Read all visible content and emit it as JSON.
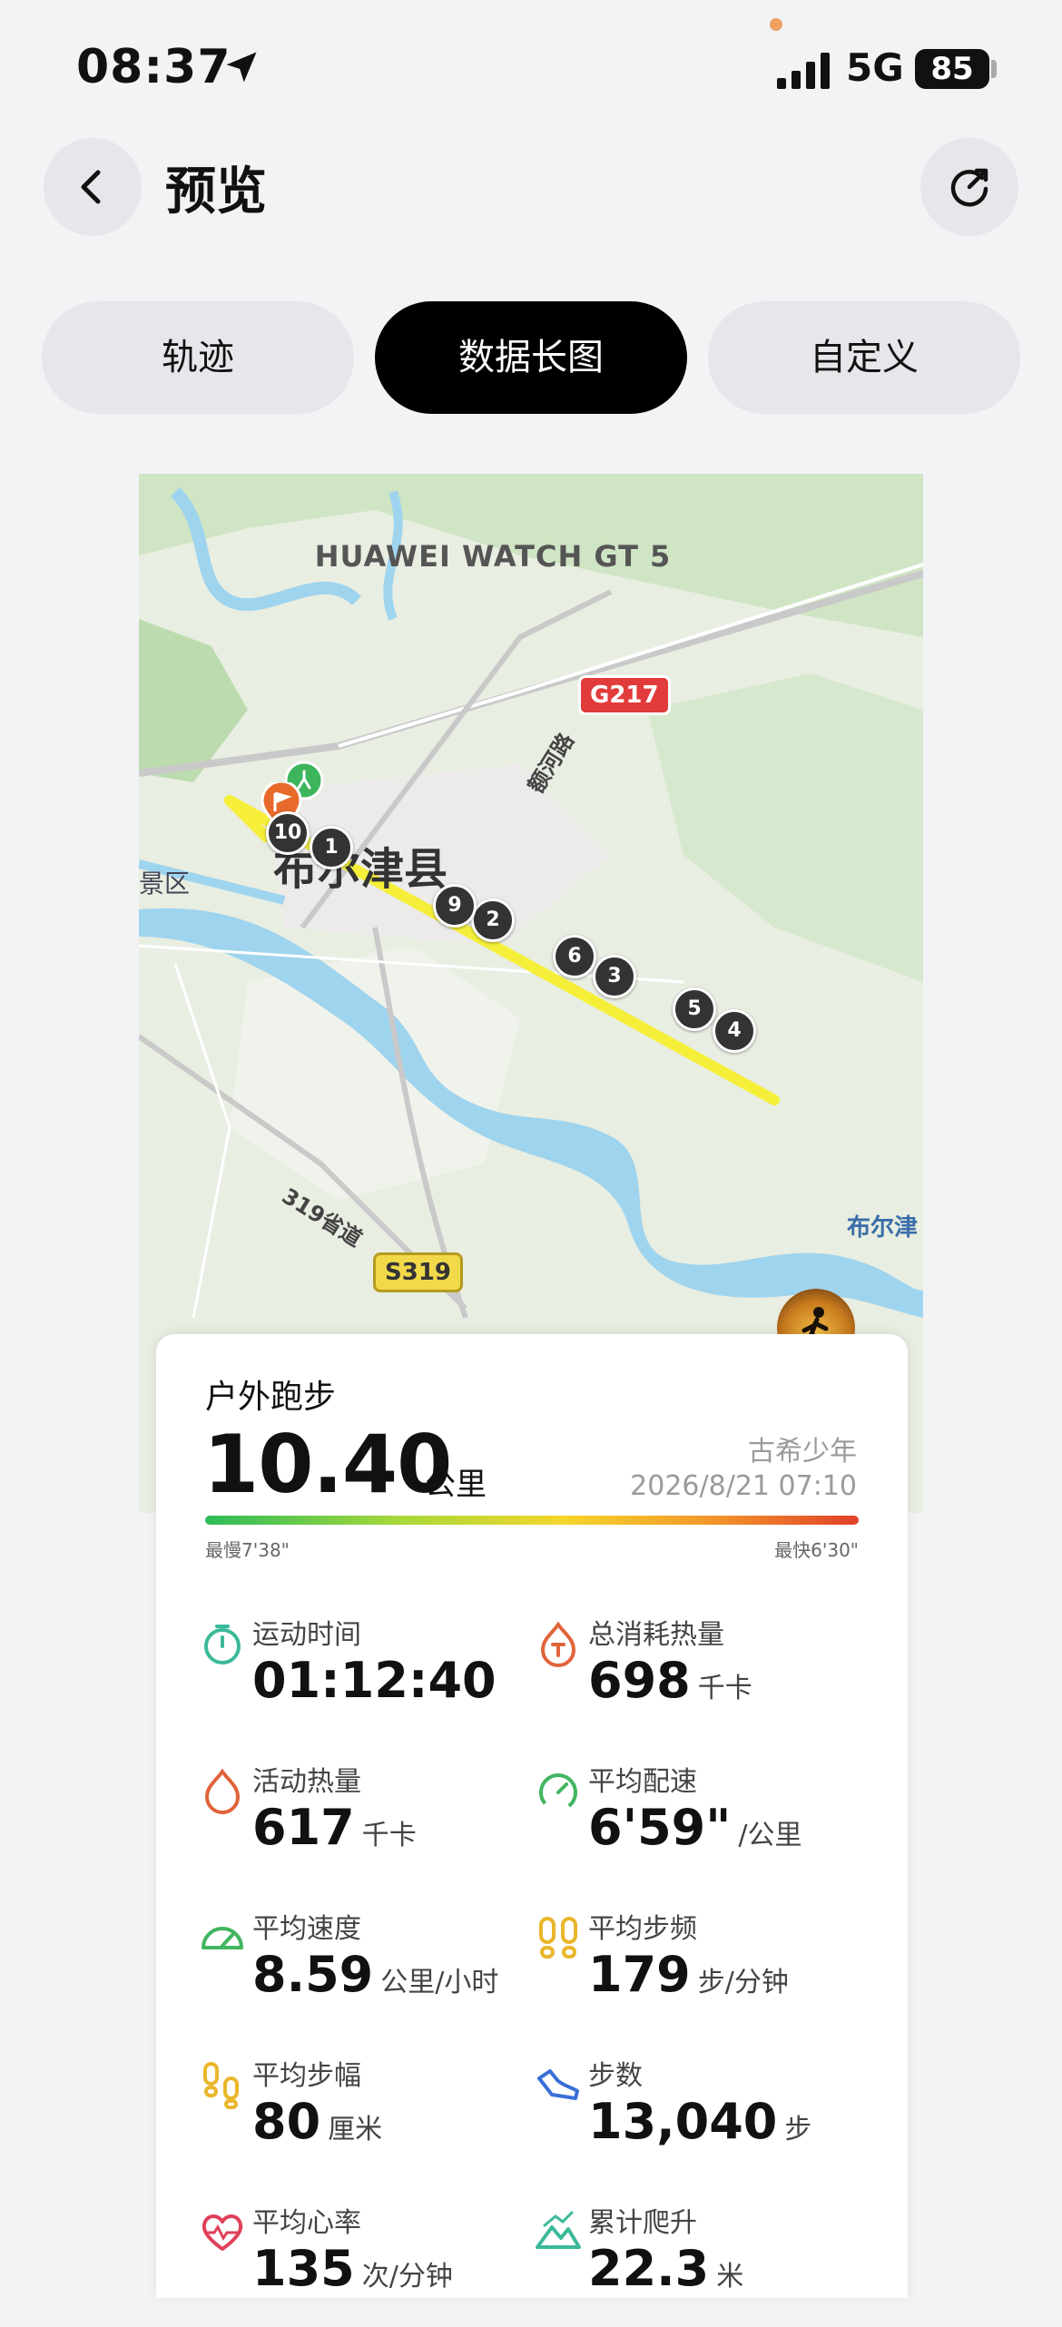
{
  "status_bar": {
    "time": "08:37",
    "network": "5G",
    "battery": "85"
  },
  "header": {
    "title": "预览"
  },
  "tabs": [
    {
      "label": "轨迹",
      "active": false
    },
    {
      "label": "数据长图",
      "active": true
    },
    {
      "label": "自定义",
      "active": false
    }
  ],
  "map": {
    "watch_model": "HUAWEI WATCH GT 5",
    "county_label": "布尔津县",
    "scenic_label": "景区",
    "road_label_1": "额河路",
    "road_label_2": "319省道",
    "river_label": "布尔津",
    "shield_g": "G217",
    "shield_s": "S319",
    "km_markers": [
      "1",
      "2",
      "3",
      "4",
      "5",
      "6",
      "9",
      "10"
    ]
  },
  "summary": {
    "sport_type": "户外跑步",
    "distance": "10.40",
    "distance_unit": "公里",
    "user_name": "古希少年",
    "datetime": "2026/8/21 07:10",
    "slowest": "最慢7'38\"",
    "fastest": "最快6'30\""
  },
  "metrics": [
    {
      "label": "运动时间",
      "value": "01:12:40",
      "unit": ""
    },
    {
      "label": "总消耗热量",
      "value": "698",
      "unit": "千卡"
    },
    {
      "label": "活动热量",
      "value": "617",
      "unit": "千卡"
    },
    {
      "label": "平均配速",
      "value": "6'59\"",
      "unit": "/公里"
    },
    {
      "label": "平均速度",
      "value": "8.59",
      "unit": "公里/小时"
    },
    {
      "label": "平均步频",
      "value": "179",
      "unit": "步/分钟"
    },
    {
      "label": "平均步幅",
      "value": "80",
      "unit": "厘米"
    },
    {
      "label": "步数",
      "value": "13,040",
      "unit": "步"
    },
    {
      "label": "平均心率",
      "value": "135",
      "unit": "次/分钟"
    },
    {
      "label": "累计爬升",
      "value": "22.3",
      "unit": "米"
    }
  ]
}
